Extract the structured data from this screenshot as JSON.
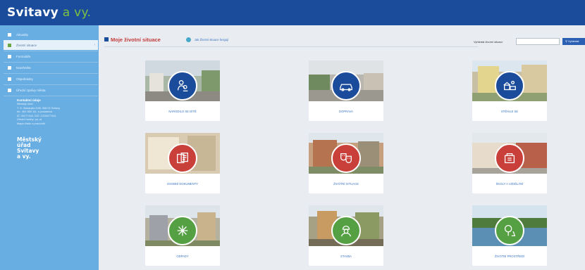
{
  "header": {
    "logo_main": "Svitavy",
    "logo_accent": " a vy."
  },
  "sidebar": {
    "items": [
      {
        "label": "Aktuality",
        "icon": "home-icon"
      },
      {
        "label": "Životní situace",
        "icon": "life-situation-icon"
      },
      {
        "label": "Formuláře",
        "icon": "form-icon"
      },
      {
        "label": "Navrhněte",
        "icon": "suggest-icon"
      },
      {
        "label": "Objednávky",
        "icon": "order-icon"
      },
      {
        "label": "Úřední zprávy města",
        "icon": "news-icon"
      }
    ],
    "contact": {
      "title": "Kontaktní údaje",
      "lines": [
        "Městský úřad",
        "T. G. Masaryka 5/35, 568 02 Svitavy",
        "tel.: 461 550 111, e-podatelna",
        "IČ: 00277444, DIČ: CZ00277444",
        "Úřední hodiny: po, st",
        "Mapa úřadu a pracovišť"
      ]
    },
    "office_lines": [
      "Městský",
      "úřad",
      "Svitavy",
      "a vy."
    ]
  },
  "main": {
    "title": "Moje životní situace",
    "help_link": "Jak Životní situace fungují",
    "search_label": "Vyhledat životní situaci:",
    "search_placeholder": "",
    "search_button": "Vyhledat"
  },
  "cards": [
    {
      "label": "NARODILO SE DÍTĚ",
      "icon": "baby-icon",
      "color": "#1b4b9b"
    },
    {
      "label": "DOPRAVA",
      "icon": "car-icon",
      "color": "#1b4b9b"
    },
    {
      "label": "STĚHUJI SE",
      "icon": "moving-icon",
      "color": "#1b4b9b"
    },
    {
      "label": "OSOBNÍ DOKUMENTY",
      "icon": "documents-icon",
      "color": "#c9403a"
    },
    {
      "label": "ŽIVOTNÍ SITUACE",
      "icon": "theatre-icon",
      "color": "#c9403a"
    },
    {
      "label": "ŠKOLY A VZDĚLÁNÍ",
      "icon": "school-icon",
      "color": "#c9403a"
    },
    {
      "label": "ODPADY",
      "icon": "recycle-icon",
      "color": "#56a044"
    },
    {
      "label": "STAVBA",
      "icon": "builder-icon",
      "color": "#56a044"
    },
    {
      "label": "ŽIVOTNÍ PROSTŘEDÍ",
      "icon": "tree-icon",
      "color": "#56a044"
    }
  ]
}
